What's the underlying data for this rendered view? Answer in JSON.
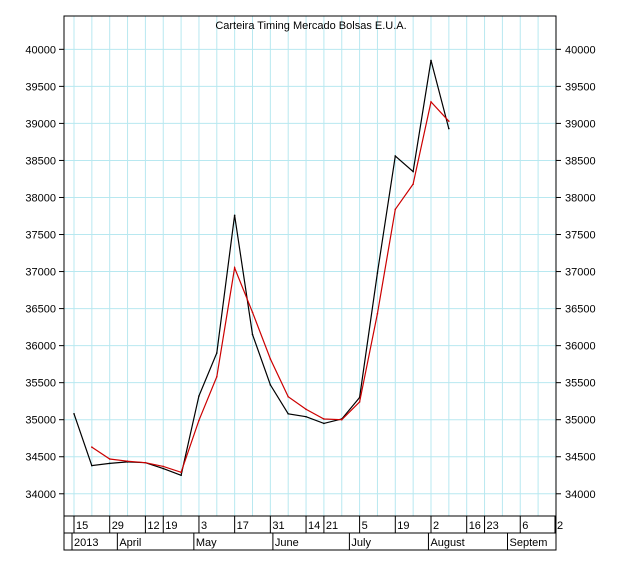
{
  "chart_data": {
    "type": "line",
    "title": "Carteira Timing Mercado Bolsas E.U.A.",
    "xlabel": "",
    "ylabel": "",
    "ylim": [
      33700,
      40450
    ],
    "yticks": [
      34000,
      34500,
      35000,
      35500,
      36000,
      36500,
      37000,
      37500,
      38000,
      38500,
      39000,
      39500,
      40000
    ],
    "grid": true,
    "gridColor": "#b8e8f0",
    "x_day_ticks": [
      "15",
      "29",
      "12",
      "19",
      "3",
      "17",
      "31",
      "14",
      "21",
      "5",
      "19",
      "2",
      "16",
      "23",
      "6",
      "2"
    ],
    "x_month_labels": [
      "2013",
      "April",
      "May",
      "June",
      "July",
      "August",
      "Septem"
    ],
    "x": [
      "2013-03-15",
      "2013-03-22",
      "2013-03-29",
      "2013-04-05",
      "2013-04-12",
      "2013-04-19",
      "2013-04-26",
      "2013-05-03",
      "2013-05-10",
      "2013-05-17",
      "2013-05-24",
      "2013-05-31",
      "2013-06-07",
      "2013-06-14",
      "2013-06-21",
      "2013-06-28",
      "2013-07-05",
      "2013-07-12",
      "2013-07-19",
      "2013-07-26",
      "2013-08-02",
      "2013-08-09"
    ],
    "series": [
      {
        "color": "#000000",
        "values": [
          35080,
          34380,
          34410,
          34430,
          34420,
          34340,
          34250,
          35320,
          35900,
          37760,
          36150,
          35470,
          35080,
          35040,
          34950,
          35010,
          35300,
          36980,
          38560,
          38350,
          39850,
          38930
        ]
      },
      {
        "color": "#cc0000",
        "values": [
          null,
          34630,
          34470,
          34440,
          34420,
          34370,
          34290,
          34990,
          35580,
          37050,
          36450,
          35820,
          35310,
          35140,
          35010,
          35000,
          35240,
          36430,
          37840,
          38180,
          39290,
          39030
        ]
      }
    ]
  }
}
